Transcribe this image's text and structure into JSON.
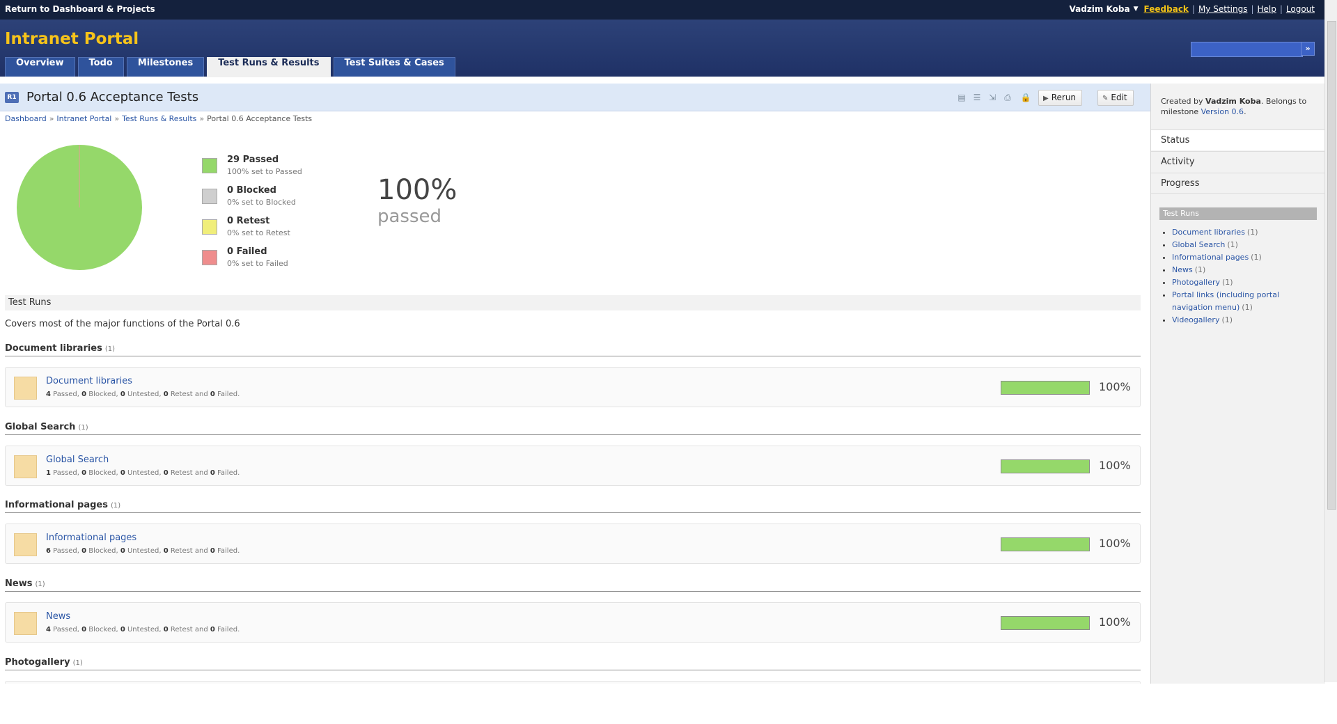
{
  "topbar": {
    "return_label": "Return to Dashboard & Projects",
    "user_name": "Vadzim Koba",
    "links": [
      "Feedback",
      "My Settings",
      "Help",
      "Logout"
    ]
  },
  "header": {
    "app_title": "Intranet Portal",
    "search_go": "»",
    "tabs": [
      "Overview",
      "Todo",
      "Milestones",
      "Test Runs & Results",
      "Test Suites & Cases"
    ],
    "active_tab": "Test Runs & Results"
  },
  "page": {
    "badge": "R1",
    "title": "Portal 0.6 Acceptance Tests",
    "buttons": {
      "rerun": "Rerun",
      "edit": "Edit"
    },
    "breadcrumb": [
      "Dashboard",
      "Intranet Portal",
      "Test Runs & Results",
      "Portal 0.6 Acceptance Tests"
    ]
  },
  "summary": {
    "legend": [
      {
        "title": "29 Passed",
        "sub": "100% set to Passed",
        "color": "#95d86a"
      },
      {
        "title": "0 Blocked",
        "sub": "0% set to Blocked",
        "color": "#cfcfcf"
      },
      {
        "title": "0 Retest",
        "sub": "0% set to Retest",
        "color": "#f0ee7a"
      },
      {
        "title": "0 Failed",
        "sub": "0% set to Failed",
        "color": "#ef8d8d"
      }
    ],
    "percent": "100%",
    "percent_label": "passed",
    "pie": {
      "passed": 29,
      "blocked": 0,
      "retest": 0,
      "failed": 0
    }
  },
  "test_runs": {
    "section_title": "Test Runs",
    "description": "Covers most of the major functions of the Portal 0.6",
    "groups": [
      {
        "title": "Document libraries",
        "count": "(1)",
        "run": "Document libraries",
        "passed": "4",
        "blocked": "0",
        "untested": "0",
        "retest": "0",
        "failed": "0",
        "progress": 1.0,
        "percent": "100%"
      },
      {
        "title": "Global Search",
        "count": "(1)",
        "run": "Global Search",
        "passed": "1",
        "blocked": "0",
        "untested": "0",
        "retest": "0",
        "failed": "0",
        "progress": 1.0,
        "percent": "100%"
      },
      {
        "title": "Informational pages",
        "count": "(1)",
        "run": "Informational pages",
        "passed": "6",
        "blocked": "0",
        "untested": "0",
        "retest": "0",
        "failed": "0",
        "progress": 1.0,
        "percent": "100%"
      },
      {
        "title": "News",
        "count": "(1)",
        "run": "News",
        "passed": "4",
        "blocked": "0",
        "untested": "0",
        "retest": "0",
        "failed": "0",
        "progress": 1.0,
        "percent": "100%"
      },
      {
        "title": "Photogallery",
        "count": "(1)"
      }
    ],
    "stats_words": {
      "passed": " Passed, ",
      "blocked": " Blocked, ",
      "untested": " Untested, ",
      "retest": " Retest and ",
      "failed": " Failed."
    }
  },
  "sidebar": {
    "created_prefix": "Created by ",
    "created_user": "Vadzim Koba",
    "created_middle": ". Belongs to milestone ",
    "milestone": "Version 0.6",
    "created_suffix": ".",
    "nav": [
      "Status",
      "Activity",
      "Progress"
    ],
    "test_runs_header": "Test Runs",
    "test_runs": [
      {
        "name": "Document libraries",
        "count": "(1)"
      },
      {
        "name": "Global Search",
        "count": "(1)"
      },
      {
        "name": "Informational pages",
        "count": "(1)"
      },
      {
        "name": "News",
        "count": "(1)"
      },
      {
        "name": "Photogallery",
        "count": "(1)"
      },
      {
        "name": "Portal links (including portal navigation menu)",
        "count": "(1)"
      },
      {
        "name": "Videogallery",
        "count": "(1)"
      }
    ]
  }
}
